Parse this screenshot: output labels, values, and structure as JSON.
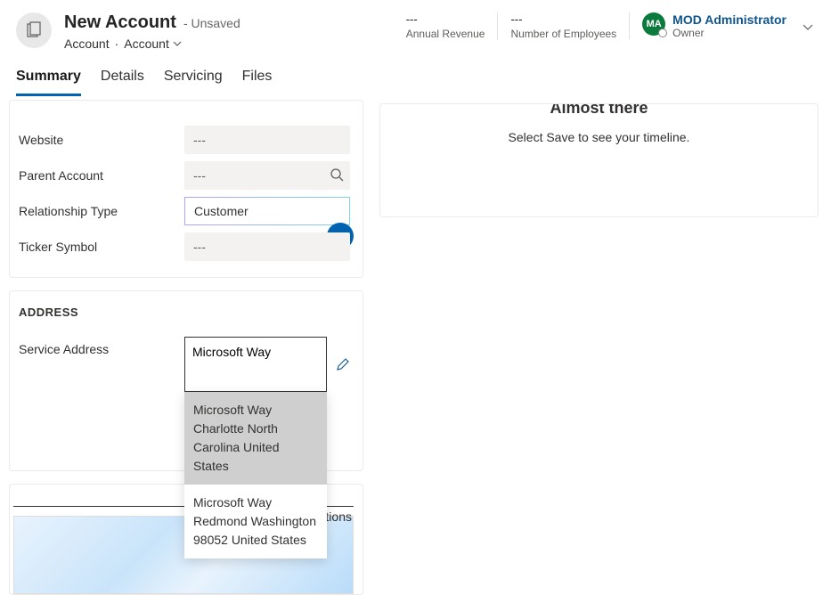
{
  "header": {
    "title": "New Account",
    "unsaved_suffix": "- Unsaved",
    "entity_label": "Account",
    "form_switcher_label": "Account",
    "fields": {
      "annual_revenue_value": "---",
      "annual_revenue_label": "Annual Revenue",
      "num_employees_value": "---",
      "num_employees_label": "Number of Employees"
    },
    "owner": {
      "initials": "MA",
      "name": "MOD Administrator",
      "label": "Owner"
    }
  },
  "tabs": {
    "summary": "Summary",
    "details": "Details",
    "servicing": "Servicing",
    "files": "Files"
  },
  "fields": {
    "website_label": "Website",
    "website_value": "---",
    "parent_account_label": "Parent Account",
    "parent_account_value": "---",
    "relationship_type_label": "Relationship Type",
    "relationship_type_value": "Customer",
    "ticker_symbol_label": "Ticker Symbol",
    "ticker_symbol_value": "---"
  },
  "address": {
    "section_title": "ADDRESS",
    "service_address_label": "Service Address",
    "service_address_value": "Microsoft Way",
    "suggestions": [
      "Microsoft Way Charlotte North Carolina United States",
      "Microsoft Way Redmond Washington 98052 United States"
    ]
  },
  "right_panel": {
    "title": "Almost there",
    "subtitle": "Select Save to see your timeline."
  },
  "mini": {
    "ctions_label": "ctions"
  }
}
